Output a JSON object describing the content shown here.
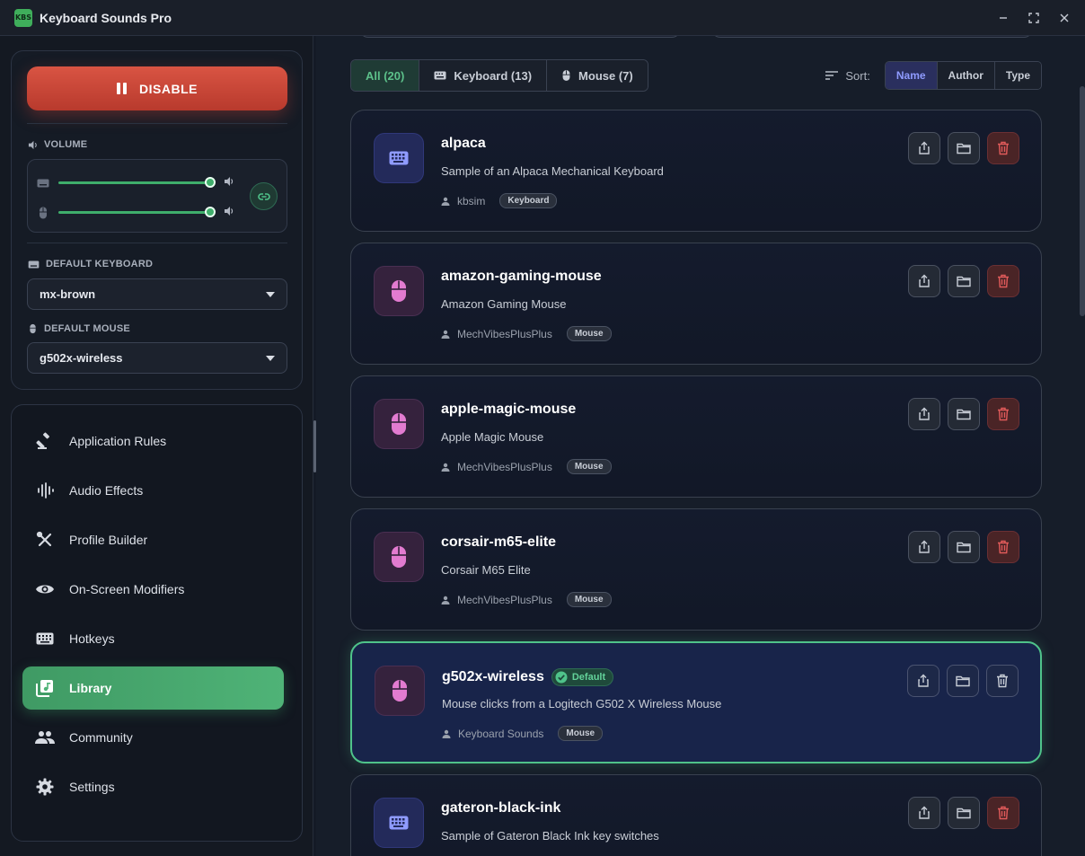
{
  "window": {
    "title": "Keyboard Sounds Pro",
    "logo_text": "KBS"
  },
  "controls": {
    "disable_label": "DISABLE",
    "volume_label": "VOLUME",
    "default_keyboard_label": "DEFAULT KEYBOARD",
    "default_keyboard_value": "mx-brown",
    "default_mouse_label": "DEFAULT MOUSE",
    "default_mouse_value": "g502x-wireless",
    "keyboard_volume_level": 1.0,
    "mouse_volume_level": 1.0
  },
  "nav": {
    "items": [
      {
        "label": "Application Rules",
        "icon": "gavel-icon"
      },
      {
        "label": "Audio Effects",
        "icon": "waveform-icon"
      },
      {
        "label": "Profile Builder",
        "icon": "tools-icon"
      },
      {
        "label": "On-Screen Modifiers",
        "icon": "eye-icon"
      },
      {
        "label": "Hotkeys",
        "icon": "keyboard-icon"
      },
      {
        "label": "Library",
        "icon": "library-music-icon",
        "active": true
      },
      {
        "label": "Community",
        "icon": "people-icon"
      },
      {
        "label": "Settings",
        "icon": "gear-icon"
      }
    ]
  },
  "filters": {
    "all": "All (20)",
    "keyboard": "Keyboard (13)",
    "mouse": "Mouse (7)",
    "active": "all"
  },
  "sort": {
    "label": "Sort:",
    "options": [
      "Name",
      "Author",
      "Type"
    ],
    "active": "Name"
  },
  "library": {
    "default_badge": "Default",
    "items": [
      {
        "name": "alpaca",
        "description": "Sample of an Alpaca Mechanical Keyboard",
        "author": "kbsim",
        "type": "Keyboard",
        "icon": "keyboard-icon",
        "default": false
      },
      {
        "name": "amazon-gaming-mouse",
        "description": "Amazon Gaming Mouse",
        "author": "MechVibesPlusPlus",
        "type": "Mouse",
        "icon": "mouse-icon",
        "default": false
      },
      {
        "name": "apple-magic-mouse",
        "description": "Apple Magic Mouse",
        "author": "MechVibesPlusPlus",
        "type": "Mouse",
        "icon": "mouse-icon",
        "default": false
      },
      {
        "name": "corsair-m65-elite",
        "description": "Corsair M65 Elite",
        "author": "MechVibesPlusPlus",
        "type": "Mouse",
        "icon": "mouse-icon",
        "default": false
      },
      {
        "name": "g502x-wireless",
        "description": "Mouse clicks from a Logitech G502 X Wireless Mouse",
        "author": "Keyboard Sounds",
        "type": "Mouse",
        "icon": "mouse-icon",
        "default": true
      },
      {
        "name": "gateron-black-ink",
        "description": "Sample of Gateron Black Ink key switches",
        "author": "",
        "type": "",
        "icon": "keyboard-icon",
        "default": false
      }
    ]
  },
  "colors": {
    "accent_green": "#4fb377",
    "disable_red": "#d95443",
    "keyboard_icon": "#8f9bff",
    "mouse_icon": "#e27bd0",
    "delete_red": "#e05a5a"
  }
}
